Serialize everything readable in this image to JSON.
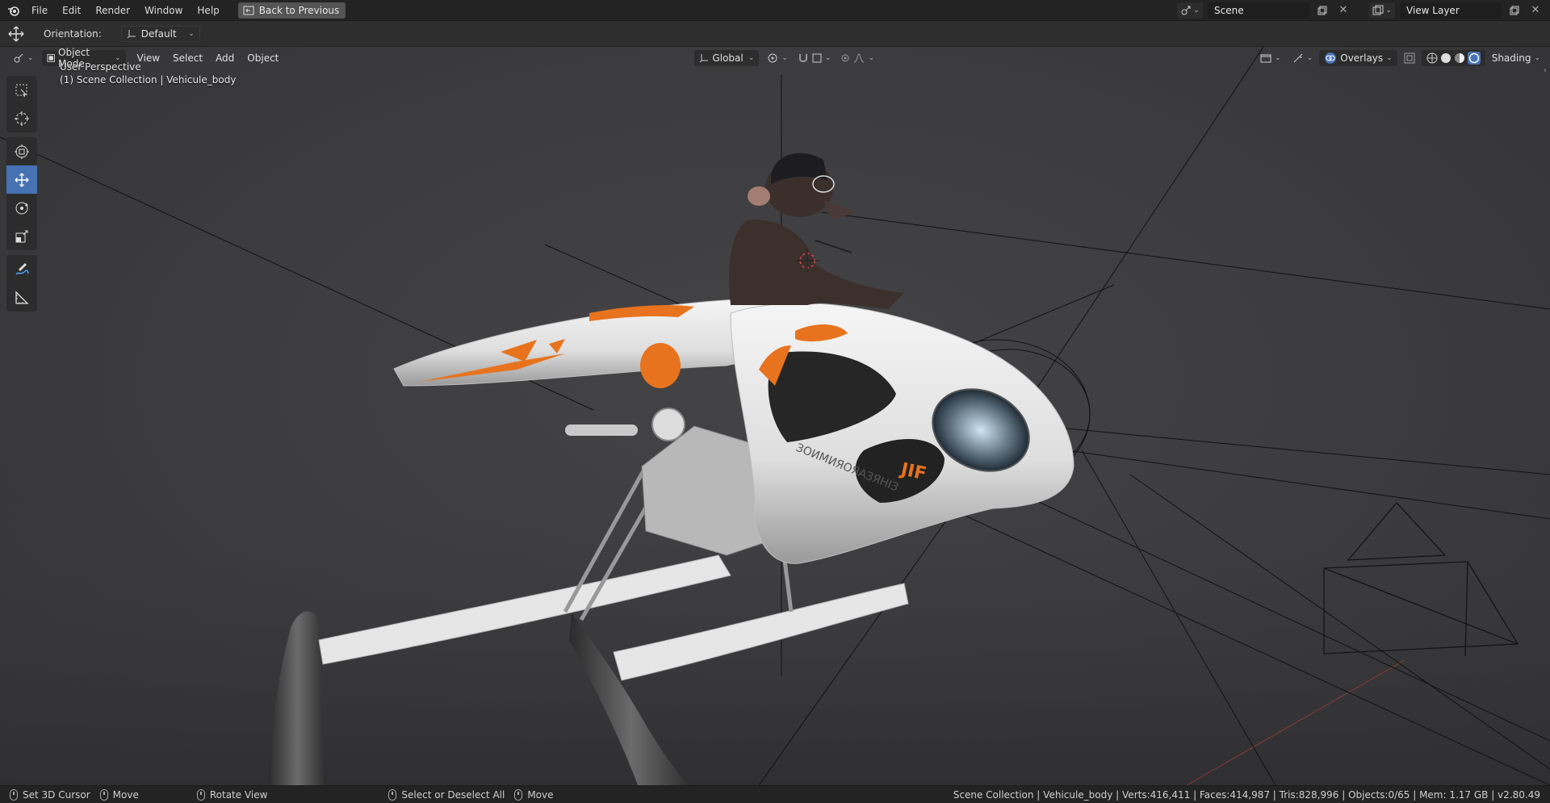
{
  "topbar": {
    "menus": [
      "File",
      "Edit",
      "Render",
      "Window",
      "Help"
    ],
    "back_button": "Back to Previous",
    "scene_name": "Scene",
    "view_layer_name": "View Layer"
  },
  "toolheader": {
    "orientation_label": "Orientation:",
    "orientation_value": "Default"
  },
  "viewport_header": {
    "mode": "Object Mode",
    "menus": [
      "View",
      "Select",
      "Add",
      "Object"
    ],
    "transform_orientation": "Global",
    "overlays_label": "Overlays",
    "shading_label": "Shading"
  },
  "viewport": {
    "perspective_label": "User Perspective",
    "collection_label": "(1) Scene Collection | Vehicule_body",
    "vehicle_decal": "ЗОИМИЯОЯАЗЯНІЗ",
    "vehicle_logo": "JIF",
    "accent_color": "#e8731e",
    "body_color": "#e9e9e9"
  },
  "toolbar": {
    "tools": [
      "select-box",
      "cursor",
      "transform",
      "move",
      "rotate",
      "scale",
      "annotate",
      "measure"
    ],
    "active_tool": "move"
  },
  "statusbar": {
    "hints": [
      {
        "label": "Set 3D Cursor"
      },
      {
        "label": "Move"
      },
      {
        "label": "Rotate View"
      },
      {
        "label": "Select or Deselect All"
      },
      {
        "label": "Move"
      }
    ],
    "stats": "Scene Collection | Vehicule_body | Verts:416,411 | Faces:414,987 | Tris:828,996 | Objects:0/65 | Mem: 1.17 GB | v2.80.49"
  },
  "colors": {
    "ui_bg": "#232323",
    "header_bg": "#2e2e2e",
    "active_blue": "#4772b3"
  }
}
